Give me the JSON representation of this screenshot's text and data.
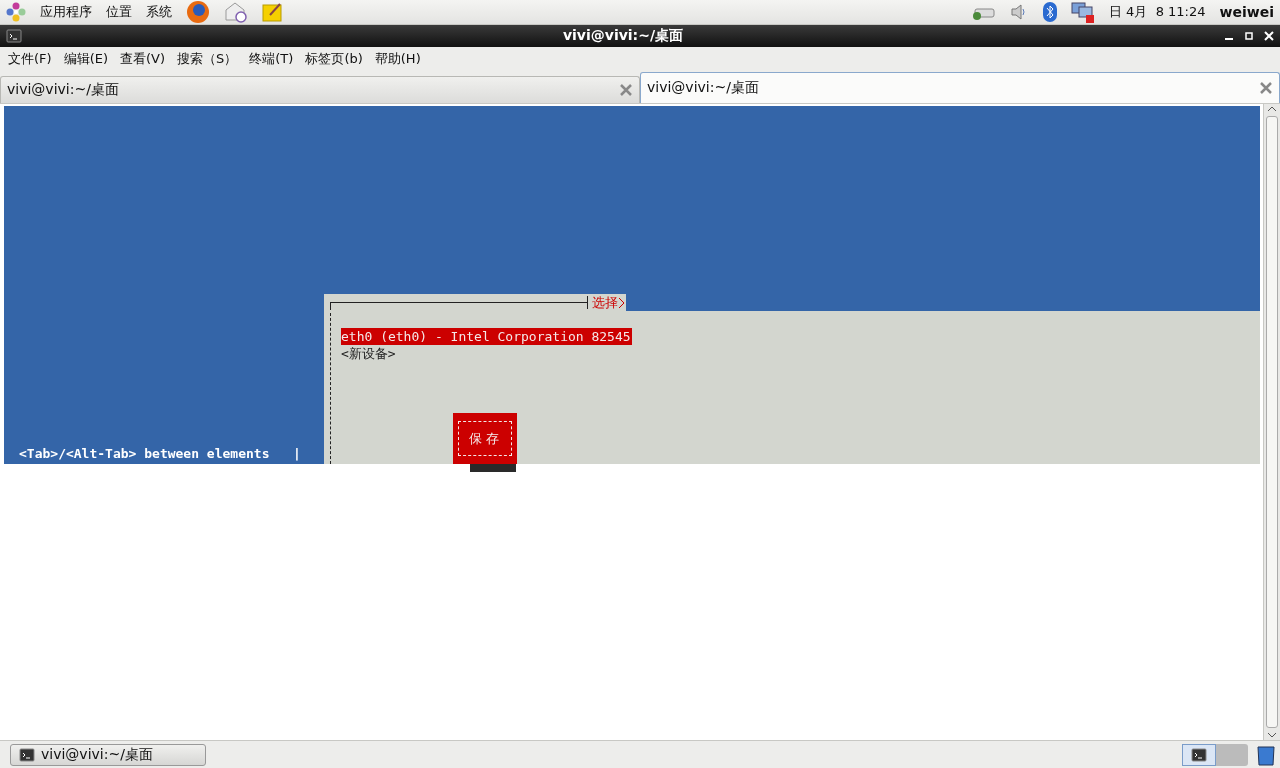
{
  "top_panel": {
    "menus": [
      "应用程序",
      "位置",
      "系统"
    ],
    "clock": "日 4月  8 11:24",
    "user": "weiwei"
  },
  "window": {
    "title": "vivi@vivi:~/桌面"
  },
  "menu_bar": [
    "文件(F)",
    "编辑(E)",
    "查看(V)",
    "搜索（S）",
    "终端(T)",
    "标签页(b)",
    "帮助(H)"
  ],
  "tabs": [
    {
      "label": "vivi@vivi:~/桌面",
      "selected": false
    },
    {
      "label": "vivi@vivi:~/桌面",
      "selected": true
    }
  ],
  "terminal": {
    "hint": "<Tab>/<Alt-Tab> between elements   |",
    "dialog": {
      "title": "选择",
      "items": [
        {
          "label": "eth0 (eth0) - Intel Corporation 82545",
          "selected": true
        },
        {
          "label": "<新设备>",
          "selected": false
        }
      ],
      "button": "保存"
    }
  },
  "taskbar": {
    "tasks": [
      {
        "label": "vivi@vivi:~/桌面",
        "selected": false
      }
    ]
  }
}
